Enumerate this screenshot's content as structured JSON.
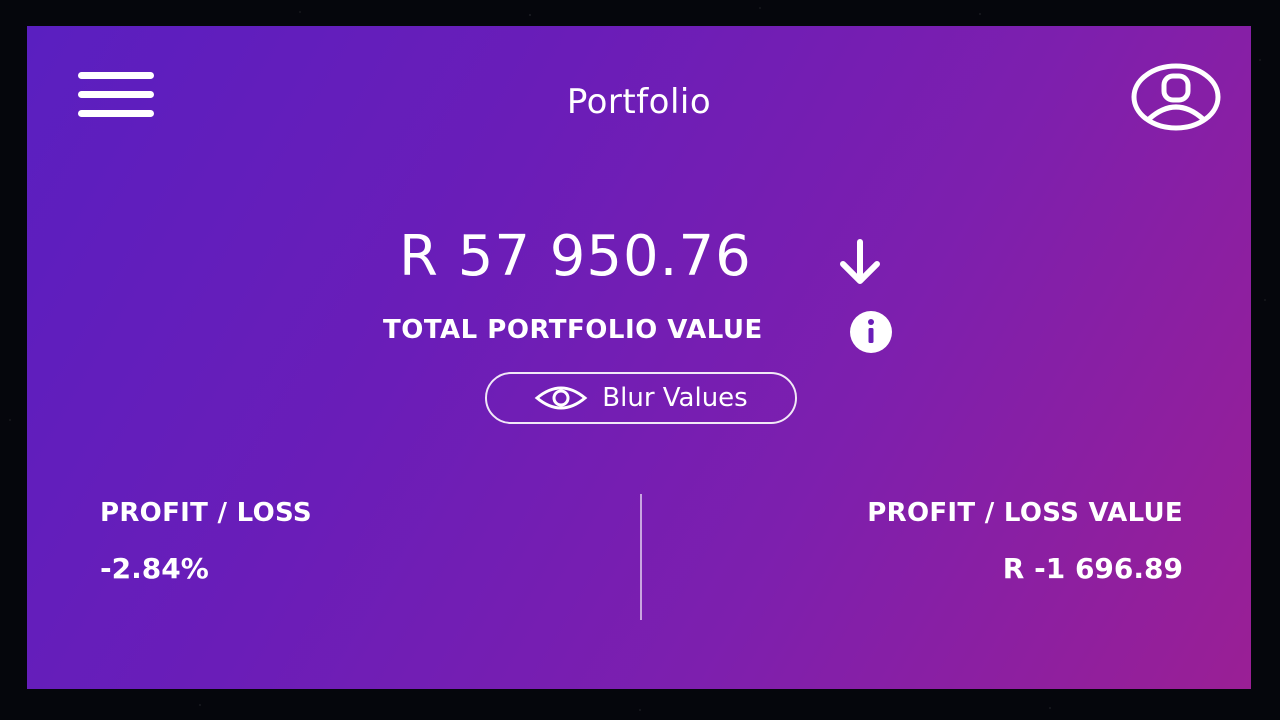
{
  "header": {
    "title": "Portfolio",
    "menu_icon": "hamburger-menu-icon",
    "profile_icon": "user-profile-icon"
  },
  "summary": {
    "total_value": "R 57 950.76",
    "trend_icon": "arrow-down-icon",
    "total_label": "TOTAL PORTFOLIO VALUE",
    "info_icon": "info-icon",
    "blur_button_label": "Blur Values",
    "blur_button_icon": "eye-icon"
  },
  "profit_loss": {
    "percent_label": "PROFIT / LOSS",
    "percent_value": "-2.84%",
    "value_label": "PROFIT / LOSS VALUE",
    "value_amount": "R -1 696.89"
  },
  "colors": {
    "gradient_start": "#5a1fc0",
    "gradient_end": "#9a1f95",
    "text": "#ffffff",
    "page_background": "#05060c"
  }
}
